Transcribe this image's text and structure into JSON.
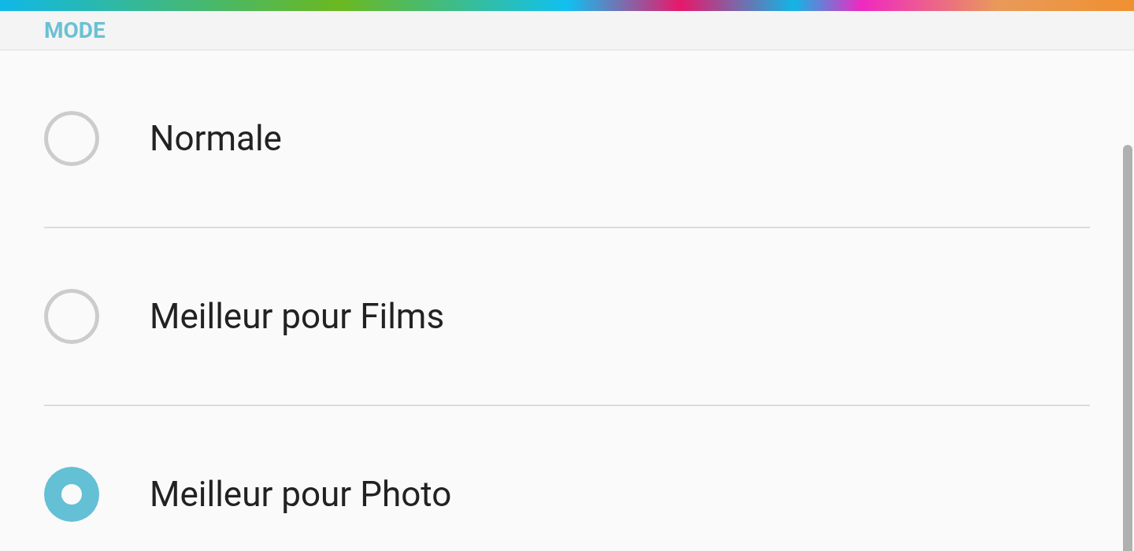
{
  "section": {
    "title": "MODE"
  },
  "options": [
    {
      "label": "Normale",
      "selected": false
    },
    {
      "label": "Meilleur pour Films",
      "selected": false
    },
    {
      "label": "Meilleur pour Photo",
      "selected": true
    }
  ]
}
